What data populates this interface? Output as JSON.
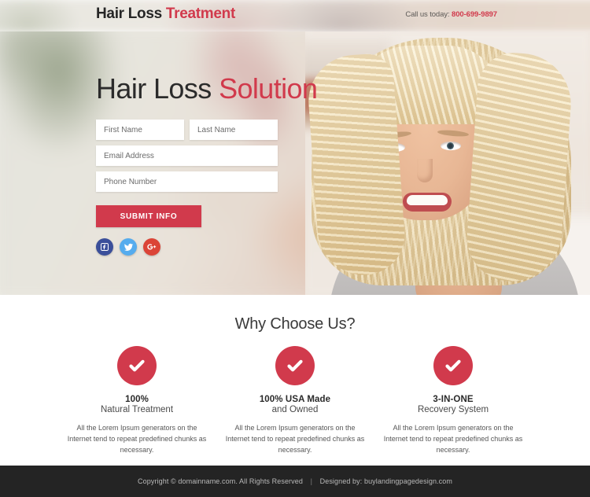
{
  "topbar": {
    "logo_primary": "Hair Loss",
    "logo_accent": "Treatment",
    "call_label": "Call us today:",
    "phone": "800-699-9897"
  },
  "hero": {
    "title_primary": "Hair Loss",
    "title_accent": "Solution",
    "form": {
      "first_name_placeholder": "First Name",
      "first_name_value": "",
      "last_name_placeholder": "Last Name",
      "last_name_value": "",
      "email_placeholder": "Email Address",
      "email_value": "",
      "phone_placeholder": "Phone Number",
      "phone_value": "",
      "submit_label": "SUBMIT INFO"
    },
    "socials": [
      {
        "name": "facebook",
        "icon": "facebook-icon",
        "color": "#3b4f9a"
      },
      {
        "name": "twitter",
        "icon": "twitter-icon",
        "color": "#55acee"
      },
      {
        "name": "googleplus",
        "icon": "google-plus-icon",
        "color": "#db4437"
      }
    ]
  },
  "features": {
    "title": "Why Choose Us?",
    "items": [
      {
        "head": "100%",
        "sub": "Natural Treatment",
        "body": "All the Lorem Ipsum generators on the Internet tend to repeat predefined chunks as necessary."
      },
      {
        "head": "100% USA Made",
        "sub": "and Owned",
        "body": "All the Lorem Ipsum generators on the Internet tend to repeat predefined chunks as necessary."
      },
      {
        "head": "3-IN-ONE",
        "sub": "Recovery System",
        "body": "All the Lorem Ipsum generators on the Internet tend to repeat predefined chunks as necessary."
      }
    ]
  },
  "footer": {
    "copyright": "Copyright © domainname.com. All Rights Reserved",
    "separator": "|",
    "designed_by_label": "Designed by:",
    "designer": "buylandingpagedesign.com"
  },
  "colors": {
    "accent": "#d13a4c",
    "footer_bg": "#242424",
    "text_dark": "#2a2a2a"
  }
}
